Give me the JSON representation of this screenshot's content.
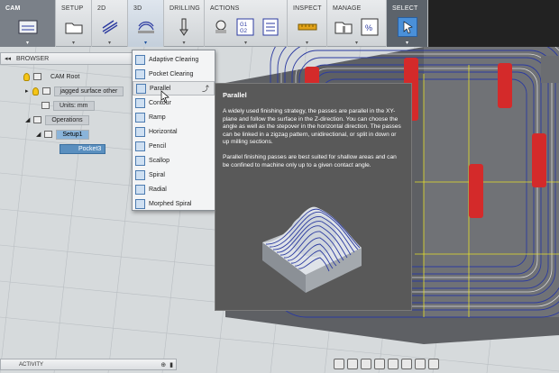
{
  "toolbar": {
    "workspace": "CAM",
    "groups": [
      "SETUP",
      "2D",
      "3D",
      "DRILLING",
      "ACTIONS",
      "INSPECT",
      "MANAGE",
      "SELECT"
    ]
  },
  "browser": {
    "title": "BROWSER",
    "items": {
      "root": "CAM Root",
      "doc": "jagged surface other",
      "units": "Units: mm",
      "operations": "Operations",
      "setup": "Setup1",
      "pocket": "Pocket3"
    }
  },
  "dropdown": {
    "items": [
      "Adaptive Clearing",
      "Pocket Clearing",
      "Parallel",
      "Contour",
      "Ramp",
      "Horizontal",
      "Pencil",
      "Scallop",
      "Spiral",
      "Radial",
      "Morphed Spiral"
    ]
  },
  "tooltip": {
    "title": "Parallel",
    "para1": "A widely used finishing strategy, the passes are parallel in the XY-plane and follow the surface in the Z-direction. You can choose the angle as well as the stepover in the horizontal direction. The passes can be linked in a zigzag pattern, unidirectional, or split in down or up milling sections.",
    "para2": "Parallel finishing passes are best suited for shallow areas and can be confined to machine only up to a given contact angle."
  },
  "activity": {
    "label": "ACTIVITY"
  },
  "colors": {
    "accent": "#4a90d9",
    "toolpath": "#2b3aa0",
    "tooltip_bg": "#595959",
    "highlight": "#5a8fbf"
  }
}
